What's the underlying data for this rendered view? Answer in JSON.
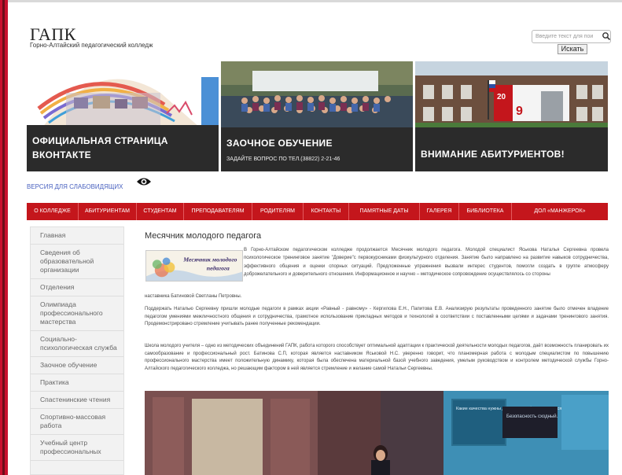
{
  "header": {
    "logo_title": "ГАПК",
    "logo_subtitle": "Горно-Алтайский педагогический колледж",
    "search_placeholder": "Введите текст для пои",
    "search_button": "Искать"
  },
  "banners": [
    {
      "title": "ОФИЦИАЛЬНАЯ СТРАНИЦА ВКОНТАКТЕ",
      "subtitle": ""
    },
    {
      "title": "ЗАОЧНОЕ ОБУЧЕНИЕ",
      "subtitle": "ЗАДАЙТЕ ВОПРОС ПО ТЕЛ.(38822) 2-21-46"
    },
    {
      "title": "ВНИМАНИЕ АБИТУРИЕНТОВ!",
      "subtitle": ""
    }
  ],
  "accessibility": {
    "vision_link": "ВЕРСИЯ ДЛЯ СЛАБОВИДЯЩИХ"
  },
  "nav": {
    "items": [
      "О КОЛЛЕДЖЕ",
      "АБИТУРИЕНТАМ",
      "СТУДЕНТАМ",
      "ПРЕПОДАВАТЕЛЯМ",
      "РОДИТЕЛЯМ",
      "КОНТАКТЫ",
      "ПАМЯТНЫЕ ДАТЫ",
      "ГАЛЕРЕЯ",
      "БИБЛИОТЕКА",
      "ДОЛ «МАНЖЕРОК»"
    ]
  },
  "sidebar": {
    "items": [
      "Главная",
      "Сведения об образовательной организации",
      "Отделения",
      "Олимпиада профессионального мастерства",
      "Социально-психологическая служба",
      "Заочное обучение",
      "Практика",
      "Спастенинские чтения",
      "Спортивно-массовая работа",
      "Учебный центр профессиональных"
    ]
  },
  "article": {
    "title": "Месячник молодого педагога",
    "thumb_text_1": "Месячник молодого",
    "thumb_text_2": "педагога",
    "p1": "В Горно-Алтайском педагогическом колледже продолжается Месячник молодого педагога. Молодой специалист Яськова Наталья Сергеевна провела психологическое тренинговое занятие \"Доверие\"с первокурсниками физкультурного отделения. Занятие было направлено на развитие навыков сотрудничества, эффективного общения и оценки спорных ситуаций. Предложенные упражнения вызвали интерес студентов, помогли создать в группе атмосферу доброжелательного и доверительного отношения. Информационное и научно – методическое сопровождение осуществлялось со стороны",
    "p1_end": "наставника Батиновой Светланы Петровны.",
    "p2": "Поддержать Наталью Сергеевну пришли молодые педагоги в рамках акции «Равный - равному» - Кергилова Е.Н., Папитова Е.В. Анализирую результаты проведенного занятие было отмечен владение педагогом умениями межличностного общения и сотрудничества, грамотное использование прикладных методов и технологий в соответствии с поставленными целями и задачами тренингового занятия. Продемонстрировано стремление учитывать ранее полученные рекомендации.",
    "p3": "Школа молодого учителя – одно из методических объединений ГАПК, работа которого способствует оптимальной адаптации к практической деятельности молодых педагогов, даёт возможность планировать их самообразование и профессиональный рост. Батинова С.П, которая является наставником Яськовой Н.С. уверенно говорит, что планомерная работа с молодым специалистом по повышению профессионального мастерства имеет положительную динамику, которая была обеспечена материальной базой учебного заведения, умелым руководством и контролем методической службы Горно-Алтайского педагогического колледжа, но решающим фактором в ней является стремление и желание самой Натальи Сергеевны."
  },
  "photo": {
    "board_text_1": "Какие качества нужны для того, что бы подружиться?",
    "board_text_2": "Безопасность сходный."
  }
}
